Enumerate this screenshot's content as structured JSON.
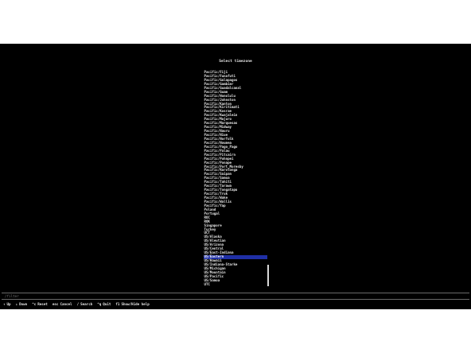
{
  "title": "Select timezone",
  "timezones": [
    "Pacific/Fiji",
    "Pacific/Funafuti",
    "Pacific/Galapagos",
    "Pacific/Gambier",
    "Pacific/Guadalcanal",
    "Pacific/Guam",
    "Pacific/Honolulu",
    "Pacific/Johnston",
    "Pacific/Kanton",
    "Pacific/Kiritimati",
    "Pacific/Kosrae",
    "Pacific/Kwajalein",
    "Pacific/Majuro",
    "Pacific/Marquesas",
    "Pacific/Midway",
    "Pacific/Nauru",
    "Pacific/Niue",
    "Pacific/Norfolk",
    "Pacific/Noumea",
    "Pacific/Pago_Pago",
    "Pacific/Palau",
    "Pacific/Pitcairn",
    "Pacific/Pohnpei",
    "Pacific/Ponape",
    "Pacific/Port_Moresby",
    "Pacific/Rarotonga",
    "Pacific/Saipan",
    "Pacific/Samoa",
    "Pacific/Tahiti",
    "Pacific/Tarawa",
    "Pacific/Tongatapu",
    "Pacific/Truk",
    "Pacific/Wake",
    "Pacific/Wallis",
    "Pacific/Yap",
    "Poland",
    "Portugal",
    "ROC",
    "ROK",
    "Singapore",
    "Turkey",
    "UCT",
    "US/Alaska",
    "US/Aleutian",
    "US/Arizona",
    "US/Central",
    "US/East-Indiana",
    "US/Eastern",
    "US/Hawaii",
    "US/Indiana-Starke",
    "US/Michigan",
    "US/Mountain",
    "US/Pacific",
    "US/Samoa",
    "UTC"
  ],
  "selected": "US/Eastern",
  "selected_index": 47,
  "filter": {
    "placeholder": "/filter",
    "value": ""
  },
  "help": [
    {
      "key": "↑",
      "action": "Up"
    },
    {
      "key": "↓",
      "action": "Down"
    },
    {
      "key": "^c",
      "action": "Reset"
    },
    {
      "key": "esc",
      "action": "Cancel"
    },
    {
      "key": "/",
      "action": "Search"
    },
    {
      "key": "^q",
      "action": "Quit"
    },
    {
      "key": "f1",
      "action": "Show/Hide help"
    }
  ],
  "colors": {
    "background": "#000000",
    "text": "#e8e8e8",
    "selection": "#1f2fa6",
    "muted": "#777777"
  }
}
